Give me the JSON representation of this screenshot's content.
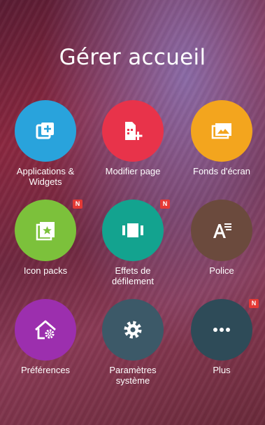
{
  "title": "Gérer accueil",
  "tiles": [
    {
      "label": "Applications & Widgets",
      "label_line1": "Applications &",
      "label_line2": "Widgets",
      "icon": "add-widget-icon",
      "color": "#29a3dc"
    },
    {
      "label": "Modifier page",
      "icon": "edit-page-icon",
      "color": "#e8334a"
    },
    {
      "label": "Fonds d'écran",
      "icon": "wallpaper-icon",
      "color": "#f3a51e"
    },
    {
      "label": "Icon packs",
      "icon": "icon-pack-icon",
      "color": "#7cc13b",
      "badge": "N"
    },
    {
      "label": "Effets de défilement",
      "label_line1": "Effets de",
      "label_line2": "défilement",
      "icon": "scroll-effect-icon",
      "color": "#13a38f",
      "badge": "N"
    },
    {
      "label": "Police",
      "icon": "font-icon",
      "color": "#6b4a3d"
    },
    {
      "label": "Préférences",
      "icon": "home-settings-icon",
      "color": "#9c2fae"
    },
    {
      "label": "Paramètres système",
      "label_line1": "Paramètres",
      "label_line2": "système",
      "icon": "gear-icon",
      "color": "#3c5968"
    },
    {
      "label": "Plus",
      "icon": "more-icon",
      "color": "#2e4b58",
      "badge": "N"
    }
  ]
}
